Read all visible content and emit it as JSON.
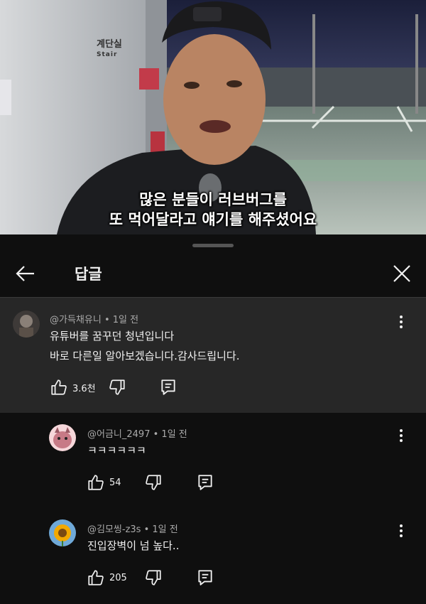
{
  "video": {
    "sign_ko": "계단실",
    "sign_en": "Stair",
    "subtitle_line1": "많은 분들이 러브버그를",
    "subtitle_line2": "또 먹어달라고 얘기를 해주셨어요"
  },
  "header": {
    "title": "답글"
  },
  "comments": [
    {
      "author": "@가득채유니",
      "time": "1일 전",
      "lines": [
        "유튜버를 꿈꾸던 청년입니다",
        "바로 다른일 알아보겠습니다.감사드립니다."
      ],
      "likes": "3.6천",
      "avatar_color": "#5a5048"
    },
    {
      "author": "@어금니_2497",
      "time": "1일 전",
      "lines": [
        "ㅋㅋㅋㅋㅋㅋ"
      ],
      "likes": "54",
      "avatar_color": "#e8b4b8"
    },
    {
      "author": "@김모씽-z3s",
      "time": "1일 전",
      "lines": [
        "진입장벽이 넘 높다.."
      ],
      "likes": "205",
      "avatar_color": "#f2a900"
    }
  ],
  "separator": "•",
  "colors": {
    "sheet_bg": "#0f0f0f",
    "highlight_bg": "#272727",
    "meta_text": "#aaaaaa"
  },
  "icons": [
    "back-arrow-icon",
    "close-icon",
    "thumb-up-icon",
    "thumb-down-icon",
    "reply-icon",
    "more-vert-icon"
  ]
}
